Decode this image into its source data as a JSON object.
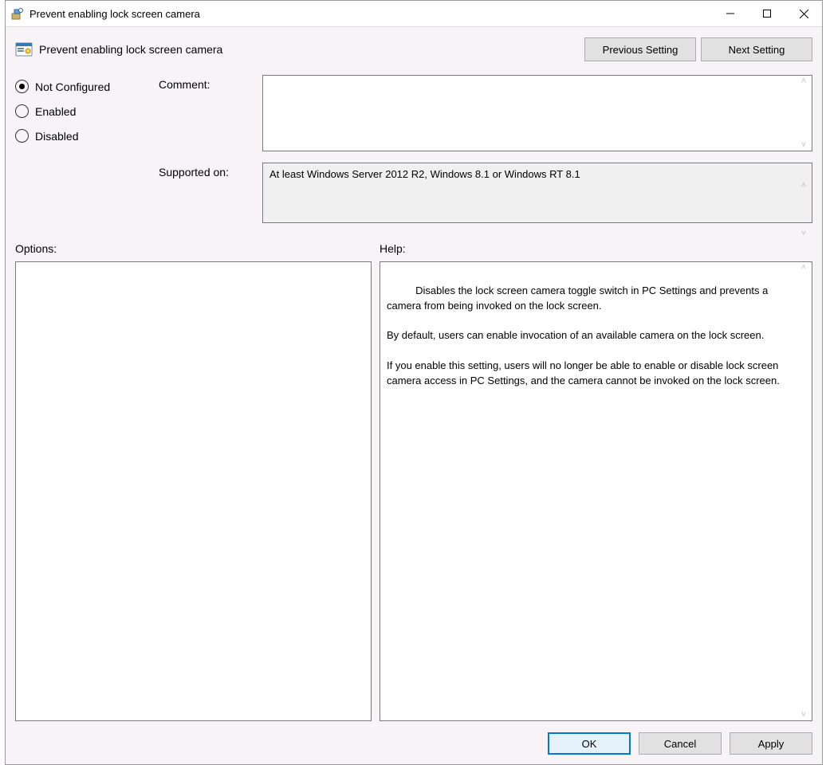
{
  "window": {
    "title": "Prevent enabling lock screen camera"
  },
  "header": {
    "title": "Prevent enabling lock screen camera",
    "prev": "Previous Setting",
    "next": "Next Setting"
  },
  "radio": {
    "not_configured": "Not Configured",
    "enabled": "Enabled",
    "disabled": "Disabled",
    "selected": "not_configured"
  },
  "labels": {
    "comment": "Comment:",
    "supported_on": "Supported on:",
    "options": "Options:",
    "help": "Help:"
  },
  "supported_on": "At least Windows Server 2012 R2, Windows 8.1 or Windows RT 8.1",
  "help_text": "Disables the lock screen camera toggle switch in PC Settings and prevents a camera from being invoked on the lock screen.\n\nBy default, users can enable invocation of an available camera on the lock screen.\n\nIf you enable this setting, users will no longer be able to enable or disable lock screen camera access in PC Settings, and the camera cannot be invoked on the lock screen.",
  "buttons": {
    "ok": "OK",
    "cancel": "Cancel",
    "apply": "Apply"
  }
}
